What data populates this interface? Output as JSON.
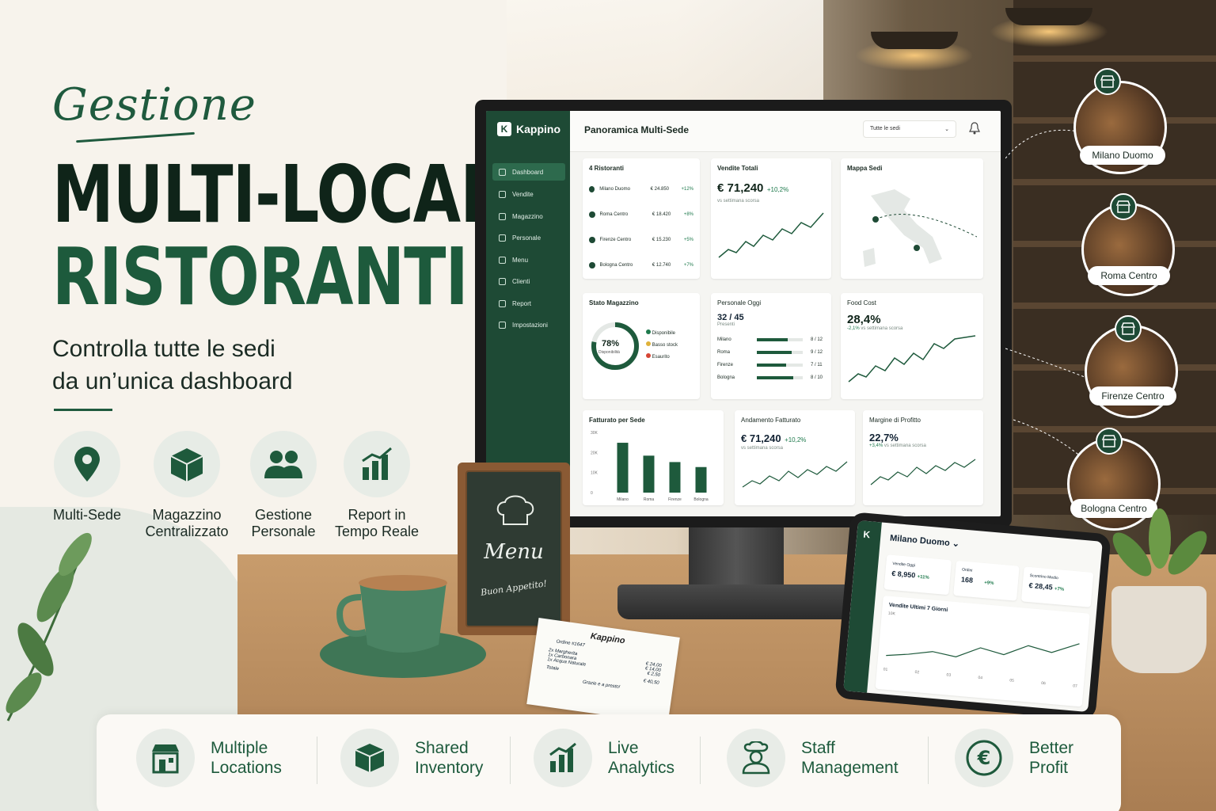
{
  "hero": {
    "script": "Gestione",
    "line1": "MULTI-LOCALE",
    "line2": "RISTORANTI",
    "subtitle_1": "Controlla tutte le sedi",
    "subtitle_2": "da un’unica dashboard"
  },
  "features": [
    {
      "label_1": "Multi-Sede",
      "label_2": "",
      "icon": "map-pin-icon"
    },
    {
      "label_1": "Magazzino",
      "label_2": "Centralizzato",
      "icon": "box-icon"
    },
    {
      "label_1": "Gestione",
      "label_2": "Personale",
      "icon": "people-icon"
    },
    {
      "label_1": "Report in",
      "label_2": "Tempo Reale",
      "icon": "bar-chart-icon"
    }
  ],
  "app": {
    "brand": "Kappino",
    "brand_mark": "K",
    "page_title": "Panoramica Multi-Sede",
    "sede_select": "Tutte le sedi",
    "nav": [
      "Dashboard",
      "Vendite",
      "Magazzino",
      "Personale",
      "Menu",
      "Clienti",
      "Report",
      "Impostazioni"
    ],
    "ristoranti": {
      "title": "4 Ristoranti",
      "rows": [
        {
          "name": "Milano Duomo",
          "value": "€ 24.850",
          "delta": "+12%"
        },
        {
          "name": "Roma Centro",
          "value": "€ 18.420",
          "delta": "+8%"
        },
        {
          "name": "Firenze Centro",
          "value": "€ 15.230",
          "delta": "+5%"
        },
        {
          "name": "Bologna Centro",
          "value": "€ 12.740",
          "delta": "+7%"
        }
      ]
    },
    "vendite": {
      "title": "Vendite Totali",
      "value": "€ 71,240",
      "delta": "+10,2%",
      "note": "vs settimana scorsa"
    },
    "mappa": {
      "title": "Mappa Sedi"
    },
    "magazzino": {
      "title": "Stato Magazzino",
      "pct": "78%",
      "pct_label": "Disponibilità",
      "pct_value": 0.78,
      "legend": [
        {
          "label": "Disponibile",
          "color": "#1f7a4d"
        },
        {
          "label": "Basso stock",
          "color": "#e0b23a"
        },
        {
          "label": "Esaurito",
          "color": "#d64535"
        }
      ]
    },
    "personale": {
      "title": "Personale Oggi",
      "value": "32 / 45",
      "note": "Presenti",
      "rows": [
        {
          "name": "Milano",
          "count": "8 / 12",
          "fill": 0.67
        },
        {
          "name": "Roma",
          "count": "9 / 12",
          "fill": 0.75
        },
        {
          "name": "Firenze",
          "count": "7 / 11",
          "fill": 0.64
        },
        {
          "name": "Bologna",
          "count": "8 / 10",
          "fill": 0.8
        }
      ]
    },
    "foodcost": {
      "title": "Food Cost",
      "value": "28,4%",
      "delta": "-2,1%",
      "note": "vs settimana scorsa"
    },
    "fatturato_sede": {
      "title": "Fatturato per Sede"
    },
    "andamento": {
      "title": "Andamento Fatturato",
      "value": "€ 71,240",
      "delta": "+10,2%",
      "note": "vs settimana scorsa"
    },
    "margine": {
      "title": "Margine di Profitto",
      "value": "22,7%",
      "delta": "+3,4%",
      "note": "vs settimana scorsa"
    }
  },
  "chart_data": {
    "type": "bar",
    "categories": [
      "Milano",
      "Roma",
      "Firenze",
      "Bologna"
    ],
    "values": [
      24850,
      18420,
      15230,
      12740
    ],
    "ylim": [
      0,
      30000
    ],
    "yticks": [
      "30K",
      "20K",
      "10K",
      "0"
    ],
    "color": "#1e5a3c"
  },
  "tablet": {
    "title": "Milano Duomo",
    "k1_label": "Vendite Oggi",
    "k1_value": "€ 8,950",
    "k1_delta": "+11%",
    "k2_label": "Ordini",
    "k2_value": "168",
    "k2_delta": "+9%",
    "k3_label": "Scontrino Medio",
    "k3_value": "€ 28,45",
    "k3_delta": "+7%",
    "chart_title": "Vendite Ultimi 7 Giorni",
    "ylabel": "10K",
    "days": [
      "01",
      "02",
      "03",
      "04",
      "05",
      "06",
      "07"
    ]
  },
  "locations": [
    "Milano Duomo",
    "Roma Centro",
    "Firenze Centro",
    "Bologna Centro"
  ],
  "menu_board": {
    "title": "Menu",
    "tagline": "Buon Appetito!"
  },
  "receipt": {
    "brand": "Kappino",
    "order": "Ordine #1647",
    "items": [
      {
        "name": "2x Margherita",
        "price": "€ 24,00"
      },
      {
        "name": "1x Carbonara",
        "price": "€ 14,00"
      },
      {
        "name": "1x Acqua Naturale",
        "price": "€ 2,50"
      }
    ],
    "total_label": "Totale",
    "total": "€ 40,50",
    "thanks": "Grazie e a presto!"
  },
  "banner": [
    {
      "l1": "Multiple",
      "l2": "Locations"
    },
    {
      "l1": "Shared",
      "l2": "Inventory"
    },
    {
      "l1": "Live",
      "l2": "Analytics"
    },
    {
      "l1": "Staff",
      "l2": "Management"
    },
    {
      "l1": "Better",
      "l2": "Profit"
    }
  ],
  "colors": {
    "brand": "#1e4a35",
    "accent": "#1f7a4d"
  }
}
